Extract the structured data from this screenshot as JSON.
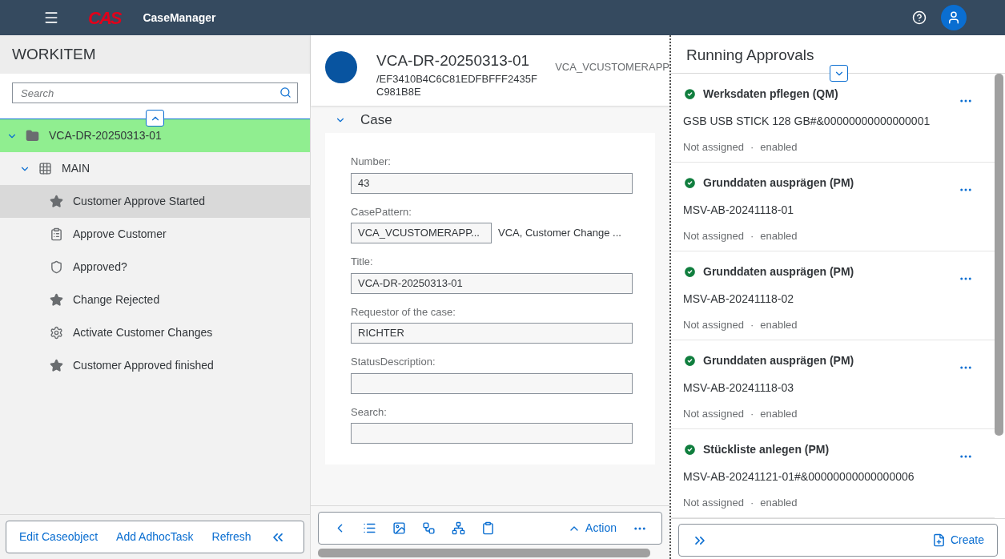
{
  "header": {
    "app_title": "CaseManager",
    "logo": "CAS"
  },
  "workitem": {
    "title": "WORKITEM",
    "search": {
      "placeholder": "Search"
    },
    "tree": [
      {
        "label": "VCA-DR-20250313-01",
        "kind": "folder",
        "expanded": true,
        "selected": false,
        "highlighted": true,
        "children": [
          {
            "label": "MAIN",
            "kind": "grid",
            "expanded": true,
            "selected": false,
            "highlighted": false,
            "children": [
              {
                "label": "Customer Approve Started",
                "kind": "star",
                "selected": true,
                "highlighted": false
              },
              {
                "label": "Approve Customer",
                "kind": "task",
                "selected": false,
                "highlighted": false
              },
              {
                "label": "Approved?",
                "kind": "shield",
                "selected": false,
                "highlighted": false
              },
              {
                "label": "Change Rejected",
                "kind": "star",
                "selected": false,
                "highlighted": false
              },
              {
                "label": "Activate Customer Changes",
                "kind": "gear",
                "selected": false,
                "highlighted": false
              },
              {
                "label": "Customer Approved finished",
                "kind": "star",
                "selected": false,
                "highlighted": false
              }
            ]
          }
        ]
      }
    ],
    "footer_actions": [
      "Edit Caseobject",
      "Add AdhocTask",
      "Refresh"
    ]
  },
  "case": {
    "title": "VCA-DR-20250313-01",
    "id": "/EF3410B4C6C81EDFBFFF2435FC981B8E",
    "pattern": "VCA_VCUSTOMERAPP",
    "section": {
      "title": "Case",
      "expanded": true,
      "fields": [
        {
          "kind": "text",
          "label": "Number:",
          "value": "43"
        },
        {
          "kind": "pattern",
          "label": "CasePattern:",
          "value": "VCA_VCUSTOMERAPP...",
          "description": "VCA, Customer Change ..."
        },
        {
          "kind": "text",
          "label": "Title:",
          "value": "VCA-DR-20250313-01"
        },
        {
          "kind": "text",
          "label": "Requestor of the case:",
          "value": "RICHTER"
        },
        {
          "kind": "text",
          "label": "StatusDescription:"
        },
        {
          "kind": "text",
          "label": "Search:"
        }
      ]
    },
    "toolbar": {
      "tools": [
        {
          "kind": "back"
        },
        {
          "kind": "list"
        },
        {
          "kind": "image"
        },
        {
          "kind": "flow"
        },
        {
          "kind": "hierarchy"
        },
        {
          "kind": "clipboard"
        }
      ],
      "action": "Action"
    }
  },
  "approvals": {
    "title": "Running Approvals",
    "items": [
      {
        "title": "Werksdaten pflegen (QM)",
        "subtitle": "GSB USB STICK 128 GB#&00000000000000001",
        "assignment": "Not assigned",
        "separator": "·",
        "status": "enabled"
      },
      {
        "title": "Grunddaten ausprägen (PM)",
        "subtitle": "MSV-AB-20241118-01",
        "assignment": "Not assigned",
        "separator": "·",
        "status": "enabled"
      },
      {
        "title": "Grunddaten ausprägen (PM)",
        "subtitle": "MSV-AB-20241118-02",
        "assignment": "Not assigned",
        "separator": "·",
        "status": "enabled"
      },
      {
        "title": "Grunddaten ausprägen (PM)",
        "subtitle": "MSV-AB-20241118-03",
        "assignment": "Not assigned",
        "separator": "·",
        "status": "enabled"
      },
      {
        "title": "Stückliste anlegen (PM)",
        "subtitle": "MSV-AB-20241121-01#&00000000000000006",
        "assignment": "Not assigned",
        "separator": "·",
        "status": "enabled"
      }
    ],
    "create": "Create"
  }
}
